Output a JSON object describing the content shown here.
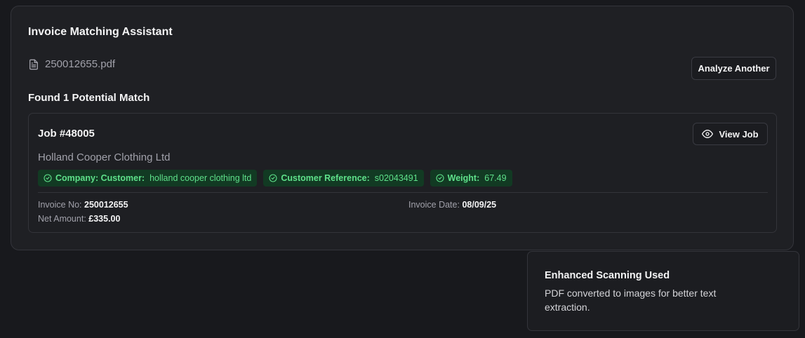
{
  "header": {
    "title": "Invoice Matching Assistant"
  },
  "file": {
    "icon": "file-text-icon",
    "name": "250012655.pdf"
  },
  "actions": {
    "analyze_another_label": "Analyze Another"
  },
  "results": {
    "summary": "Found 1 Potential Match"
  },
  "match": {
    "job_title": "Job #48005",
    "view_job_label": "View Job",
    "view_job_icon": "eye-icon",
    "company": "Holland Cooper Clothing Ltd",
    "badges": [
      {
        "label": "Company: Customer:",
        "value": "holland cooper clothing ltd",
        "icon": "check-circle-icon"
      },
      {
        "label": "Customer Reference:",
        "value": "s02043491",
        "icon": "check-circle-icon"
      },
      {
        "label": "Weight:",
        "value": "67.49",
        "icon": "check-circle-icon"
      }
    ],
    "invoice_no_label": "Invoice No:",
    "invoice_no": "250012655",
    "invoice_date_label": "Invoice Date:",
    "invoice_date": "08/09/25",
    "net_amount_label": "Net Amount:",
    "net_amount": "£335.00"
  },
  "toast": {
    "title": "Enhanced Scanning Used",
    "body": "PDF converted to images for better text extraction."
  },
  "colors": {
    "background": "#18191d",
    "card": "#1f2024",
    "badge_bg": "#123a23",
    "badge_text": "#5ee08a",
    "muted_text": "#a1a1aa"
  }
}
